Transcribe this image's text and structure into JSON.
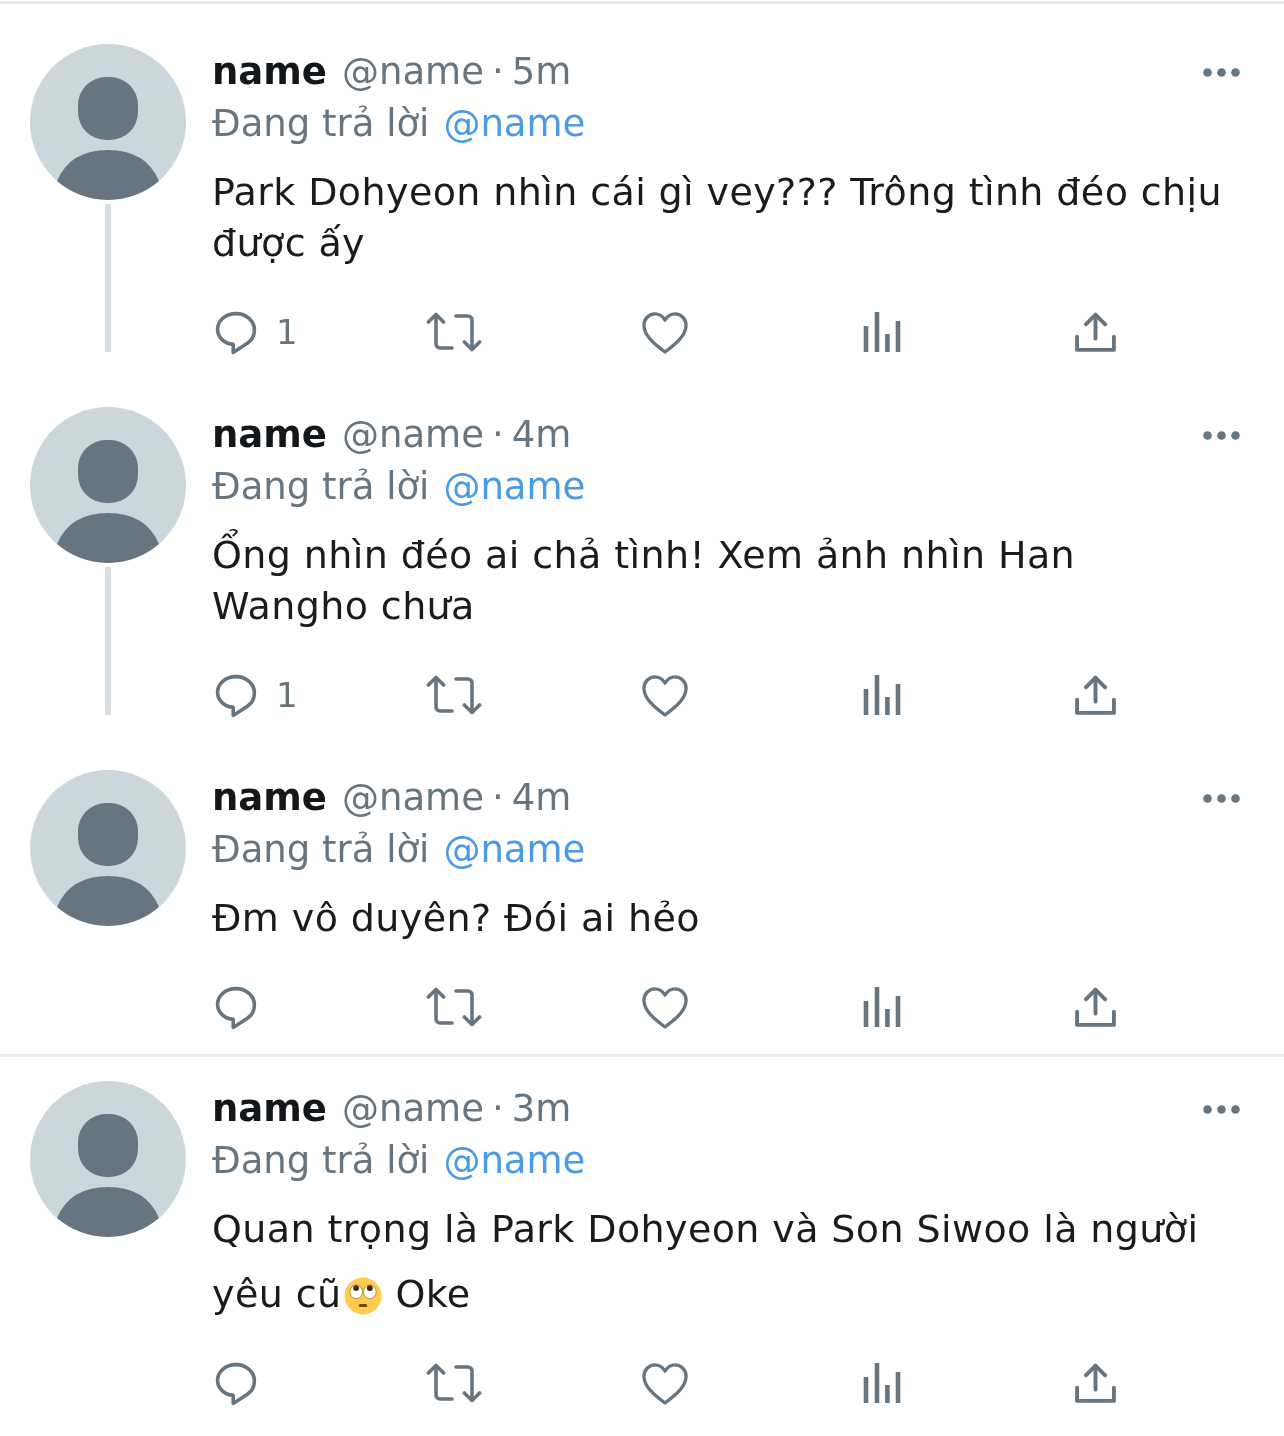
{
  "threads": [
    {
      "tweets": [
        {
          "name": "name",
          "handle": "@name",
          "separator": "·",
          "time": "5m",
          "reply_label": "Đang trả lời",
          "reply_to": "@name",
          "body": [
            {
              "segments": [
                {
                  "kind": "text",
                  "text": "Park Dohyeon nhìn cái gì vey??? Trông tình đéo chịu được ấy"
                }
              ]
            }
          ],
          "actions": [
            {
              "kind": "reply",
              "count": "1"
            },
            {
              "kind": "retweet"
            },
            {
              "kind": "like"
            },
            {
              "kind": "views"
            },
            {
              "kind": "share"
            }
          ]
        },
        {
          "name": "name",
          "handle": "@name",
          "separator": "·",
          "time": "4m",
          "reply_label": "Đang trả lời",
          "reply_to": "@name",
          "body": [
            {
              "segments": [
                {
                  "kind": "text",
                  "text": "Ổng nhìn đéo ai chả tình! Xem ảnh nhìn Han Wangho chưa"
                }
              ]
            }
          ],
          "actions": [
            {
              "kind": "reply",
              "count": "1"
            },
            {
              "kind": "retweet"
            },
            {
              "kind": "like"
            },
            {
              "kind": "views"
            },
            {
              "kind": "share"
            }
          ]
        },
        {
          "name": "name",
          "handle": "@name",
          "separator": "·",
          "time": "4m",
          "reply_label": "Đang trả lời",
          "reply_to": "@name",
          "body": [
            {
              "segments": [
                {
                  "kind": "text",
                  "text": "Đm vô duyên? Đói ai hẻo"
                }
              ]
            }
          ],
          "actions": [
            {
              "kind": "reply"
            },
            {
              "kind": "retweet"
            },
            {
              "kind": "like"
            },
            {
              "kind": "views"
            },
            {
              "kind": "share"
            }
          ]
        }
      ]
    },
    {
      "tweets": [
        {
          "name": "name",
          "handle": "@name",
          "separator": "·",
          "time": "3m",
          "reply_label": "Đang trả lời",
          "reply_to": "@name",
          "body": [
            {
              "segments": [
                {
                  "kind": "text",
                  "text": "Quan trọng là Park Dohyeon và Son Siwoo là người"
                }
              ]
            },
            {
              "segments": [
                {
                  "kind": "text",
                  "text": "yêu cũ"
                },
                {
                  "kind": "emoji"
                },
                {
                  "kind": "text",
                  "text": "Oke"
                }
              ]
            }
          ],
          "actions": [
            {
              "kind": "reply"
            },
            {
              "kind": "retweet"
            },
            {
              "kind": "like"
            },
            {
              "kind": "views"
            },
            {
              "kind": "share"
            }
          ]
        }
      ]
    }
  ]
}
